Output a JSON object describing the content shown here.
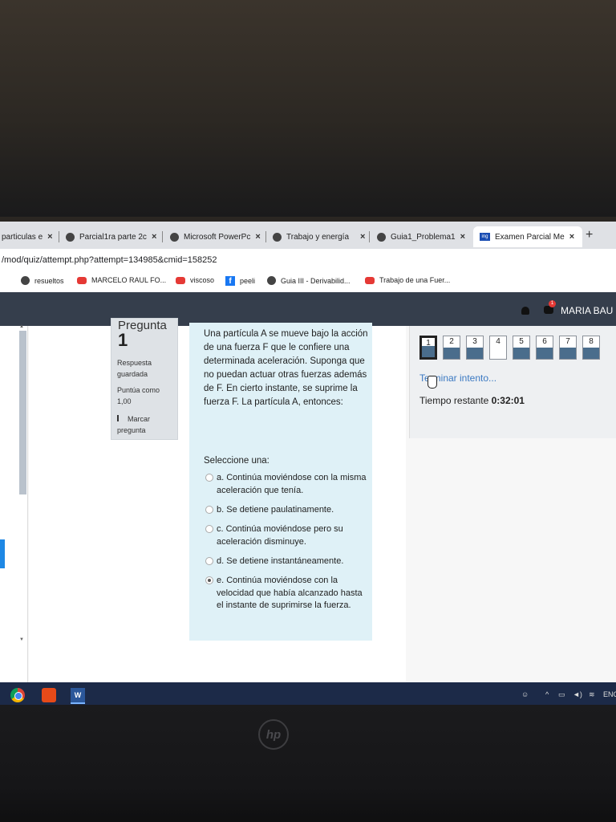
{
  "browser": {
    "tabs": [
      {
        "label": "particulas e",
        "close": "×"
      },
      {
        "label": "Parcial1ra parte 2c",
        "close": "×"
      },
      {
        "label": "Microsoft PowerPc",
        "close": "×"
      },
      {
        "label": "Trabajo y energía",
        "close": "×"
      },
      {
        "label": "Guia1_Problema1",
        "close": "×"
      },
      {
        "label": "Examen Parcial Me",
        "close": "×",
        "active": true
      }
    ],
    "new_tab": "+",
    "url": "/mod/quiz/attempt.php?attempt=134985&cmid=158252",
    "bookmarks": [
      {
        "label": "resueltos",
        "icon": "globe-icon"
      },
      {
        "label": "MARCELO RAUL FO...",
        "icon": "youtube-icon"
      },
      {
        "label": "viscoso",
        "icon": "youtube-icon"
      },
      {
        "label": "peeli",
        "icon": "facebook-icon"
      },
      {
        "label": "Guia III - Derivabilid...",
        "icon": "globe-icon"
      },
      {
        "label": "Trabajo de una Fuer...",
        "icon": "youtube-icon"
      }
    ]
  },
  "navbar": {
    "user": "MARIA BAU",
    "notification_badge": "1"
  },
  "question_info": {
    "pregunta_label": "Pregunta",
    "number": "1",
    "status": "Respuesta guardada",
    "score": "Puntúa como 1,00",
    "flag_label": "Marcar pregunta"
  },
  "question": {
    "text": "Una partícula A se mueve bajo la acción de una fuerza F que le confiere una determinada aceleración. Suponga que no puedan actuar otras fuerzas además de F. En cierto instante, se suprime la fuerza F. La partícula A, entonces:",
    "prompt": "Seleccione una:",
    "options": [
      {
        "text": "a. Continúa moviéndose con la misma aceleración que tenía.",
        "selected": false
      },
      {
        "text": "b. Se detiene paulatinamente.",
        "selected": false
      },
      {
        "text": "c. Continúa moviéndose pero su aceleración disminuye.",
        "selected": false
      },
      {
        "text": "d. Se detiene instantáneamente.",
        "selected": false
      },
      {
        "text": "e. Continúa moviéndose con la velocidad que había alcanzado hasta el instante de suprimirse la fuerza.",
        "selected": true
      }
    ]
  },
  "quiz_nav": {
    "buttons": [
      {
        "label": "1",
        "answered": true,
        "current": true
      },
      {
        "label": "2",
        "answered": true
      },
      {
        "label": "3",
        "answered": true
      },
      {
        "label": "4",
        "answered": false
      },
      {
        "label": "5",
        "answered": true
      },
      {
        "label": "6",
        "answered": true
      },
      {
        "label": "7",
        "answered": true
      },
      {
        "label": "8",
        "answered": true
      }
    ],
    "finish_label": "Terminar intento...",
    "time_label": "Tiempo restante",
    "time_value": "0:32:01"
  },
  "taskbar": {
    "word_label": "W",
    "lang": "ENG"
  }
}
